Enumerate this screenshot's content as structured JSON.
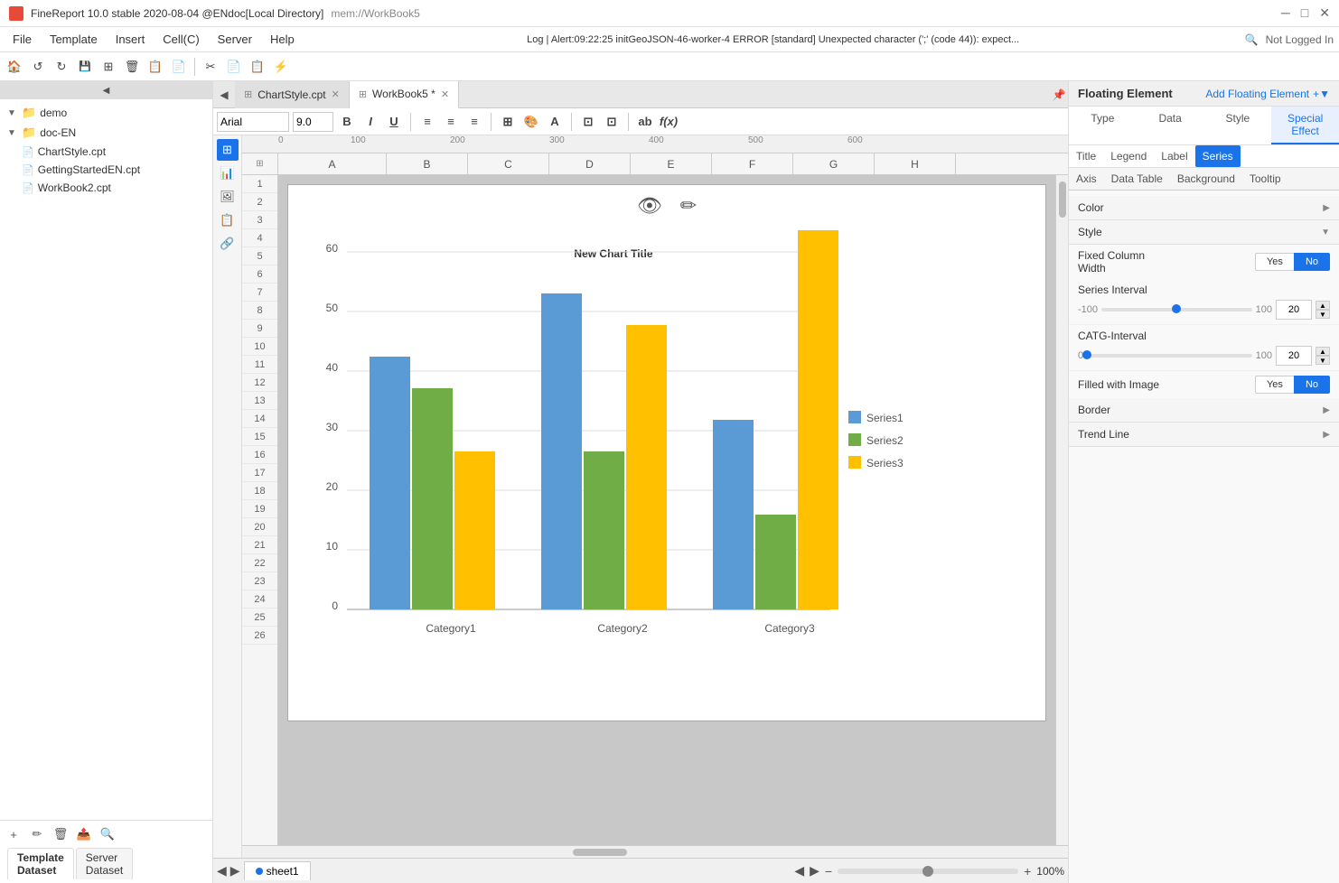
{
  "titleBar": {
    "appName": "FineReport 10.0 stable 2020-08-04 @ENdoc[Local Directory]",
    "memPath": "mem://WorkBook5",
    "minBtn": "─",
    "maxBtn": "□",
    "closeBtn": "✕"
  },
  "menuBar": {
    "items": [
      "File",
      "Template",
      "Insert",
      "Cell(C)",
      "Server",
      "Help"
    ],
    "logText": "Log | Alert:09:22:25 initGeoJSON-46-worker-4 ERROR [standard] Unexpected character (';' (code 44)): expect...",
    "searchIcon": "🔍",
    "loginText": "Not Logged In"
  },
  "toolbar": {
    "buttons": [
      "🏠",
      "↺",
      "↻",
      "⊡",
      "⊞",
      "🗑",
      "📄",
      "📋"
    ],
    "buttons2": [
      "✂",
      "📄",
      "📋",
      "⚡"
    ]
  },
  "sidebar": {
    "tree": [
      {
        "label": "demo",
        "type": "folder",
        "level": 0,
        "expanded": true
      },
      {
        "label": "doc-EN",
        "type": "folder",
        "level": 0,
        "expanded": true
      },
      {
        "label": "ChartStyle.cpt",
        "type": "file",
        "level": 1
      },
      {
        "label": "GettingStartedEN.cpt",
        "type": "file",
        "level": 1
      },
      {
        "label": "WorkBook2.cpt",
        "type": "file",
        "level": 1
      }
    ],
    "bottomBtns": [
      "+",
      "✏",
      "🗑",
      "📤",
      "🔍"
    ],
    "datasetTabs": [
      "Template\nDataset",
      "Server\nDataset"
    ]
  },
  "tabs": [
    {
      "label": "ChartStyle.cpt",
      "icon": "⊞",
      "active": false,
      "closable": true
    },
    {
      "label": "WorkBook5 *",
      "icon": "⊞",
      "active": true,
      "closable": true
    }
  ],
  "formulaBar": {
    "fontName": "Arial",
    "fontSize": "9.0",
    "boldBtn": "B",
    "italicBtn": "I",
    "underlineBtn": "U"
  },
  "chart": {
    "title": "New Chart Title",
    "categories": [
      "Category1",
      "Category2",
      "Category3"
    ],
    "series": [
      {
        "name": "Series1",
        "color": "#5b9bd5",
        "values": [
          40,
          50,
          30
        ]
      },
      {
        "name": "Series2",
        "color": "#70ad47",
        "values": [
          35,
          25,
          15
        ]
      },
      {
        "name": "Series3",
        "color": "#ffc000",
        "values": [
          25,
          45,
          60
        ]
      }
    ],
    "yAxisLabels": [
      "0",
      "10",
      "20",
      "30",
      "40",
      "50",
      "60"
    ],
    "overlayIcons": [
      "👁️‍🗨️",
      "✏️"
    ]
  },
  "colHeaders": [
    "A",
    "B",
    "C",
    "D",
    "E",
    "F",
    "G",
    "H"
  ],
  "rowNumbers": [
    "1",
    "2",
    "3",
    "4",
    "5",
    "6",
    "7",
    "8",
    "9",
    "10",
    "11",
    "12",
    "13",
    "14",
    "15",
    "16",
    "17",
    "18",
    "19",
    "20",
    "21",
    "22",
    "23",
    "24",
    "25",
    "26"
  ],
  "rightPanel": {
    "title": "Floating Element",
    "addLabel": "+▼",
    "addText": "Add Floating Element",
    "tabs": [
      "Type",
      "Data",
      "Style",
      "Special\nEffect"
    ],
    "activeTab": "Special\nEffect",
    "subTabs": [
      "Title",
      "Legend",
      "Label",
      "Series"
    ],
    "activeSubTab": "Series",
    "secondSubTabs": [
      "Axis",
      "Data Table",
      "Background",
      "Tooltip"
    ],
    "colorSection": {
      "label": "Color",
      "arrow": "▶"
    },
    "styleSection": {
      "label": "Style",
      "arrow": "▼"
    },
    "fixedColumnWidth": {
      "label": "Fixed Column\nWidth",
      "yesLabel": "Yes",
      "noLabel": "No",
      "activeBtn": "No"
    },
    "seriesInterval": {
      "label": "Series Interval",
      "minVal": "-100",
      "midVal": "0",
      "maxVal": "100",
      "inputVal": "20"
    },
    "catgInterval": {
      "label": "CATG-Interval",
      "minVal": "0",
      "maxVal": "100",
      "inputVal": "20"
    },
    "filledWithImage": {
      "label": "Filled with Image",
      "yesLabel": "Yes",
      "noLabel": "No",
      "activeBtn": "No"
    },
    "borderSection": {
      "label": "Border",
      "arrow": "▶"
    },
    "trendLine": {
      "label": "Trend Line",
      "arrow": "▶"
    }
  },
  "bottomBar": {
    "sheetName": "sheet1",
    "navBtns": [
      "◀",
      "▶",
      "−"
    ],
    "zoomIn": "+",
    "zoomOut": "−",
    "zoomLevel": "100%"
  },
  "vertToolbar": {
    "buttons": [
      "⊞",
      "📊",
      "🖼",
      "📋",
      "🔗"
    ]
  }
}
